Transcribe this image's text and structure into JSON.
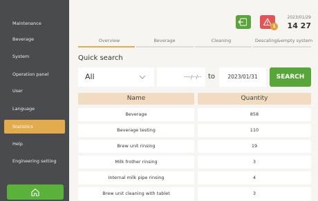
{
  "sidebar": {
    "items": [
      {
        "label": "Maintenance"
      },
      {
        "label": "Beverage"
      },
      {
        "label": "System"
      },
      {
        "label": "Operation panel"
      },
      {
        "label": "User"
      },
      {
        "label": "Language"
      },
      {
        "label": "Statistics"
      },
      {
        "label": "Help"
      },
      {
        "label": "Engineering setting"
      }
    ],
    "active_index": 6,
    "home_icon": "home-icon"
  },
  "header": {
    "exit_icon": "exit-icon",
    "alarm_icon": "warning-icon",
    "alarm_count": "1",
    "date": "2023/01/29",
    "time": "14 27"
  },
  "tabs": [
    {
      "label": "Overview",
      "active": true
    },
    {
      "label": "Beverage",
      "active": false
    },
    {
      "label": "Cleaning",
      "active": false
    },
    {
      "label": "Descaling&empty system",
      "active": false
    }
  ],
  "quick_search": {
    "title": "Quick search",
    "filter_value": "All",
    "date_from": "----/--/--",
    "to_label": "to",
    "date_to": "2023/01/31",
    "search_label": "SEARCH"
  },
  "table": {
    "headers": {
      "name": "Name",
      "quantity": "Quantity"
    },
    "rows": [
      {
        "name": "Beverage",
        "quantity": "858"
      },
      {
        "name": "Beverage testing",
        "quantity": "110"
      },
      {
        "name": "Brew unit rinsing",
        "quantity": "19"
      },
      {
        "name": "Milk frother rinsing",
        "quantity": "3"
      },
      {
        "name": "Internal milk pipe rinsing",
        "quantity": "4"
      },
      {
        "name": "Brew unit cleaning with tablet",
        "quantity": "3"
      }
    ]
  },
  "colors": {
    "sidebar_bg": "#4a4b4d",
    "accent_orange": "#e2ac4e",
    "accent_green": "#58a53a",
    "alarm_red": "#e05555",
    "table_header": "#f1dcc1"
  }
}
